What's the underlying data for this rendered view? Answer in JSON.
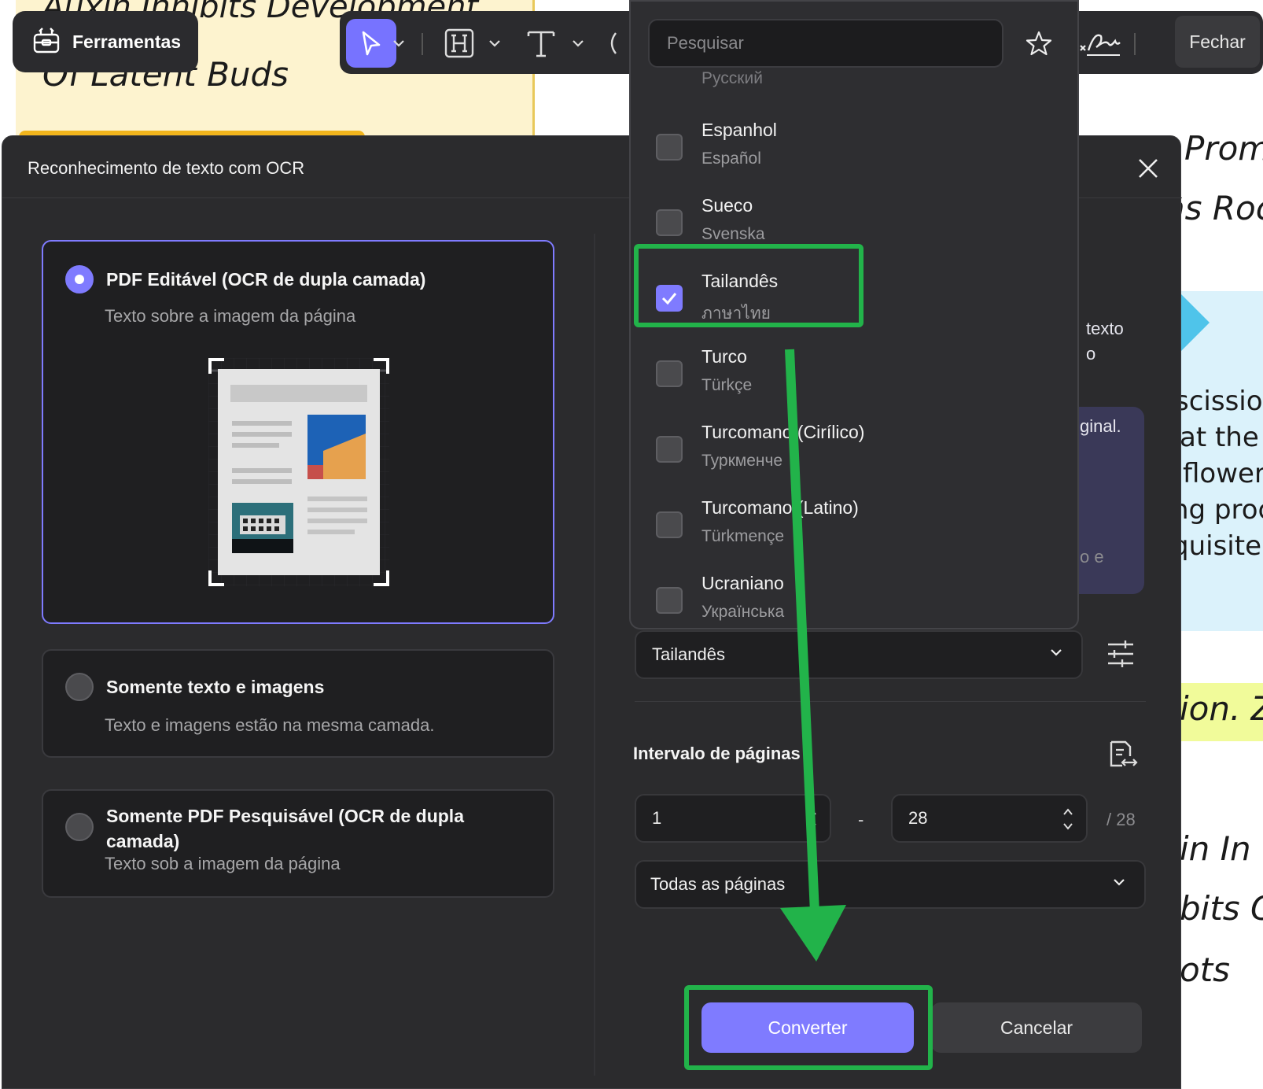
{
  "background_document": {
    "heading_line1": "Auxin Inhibits Development",
    "heading_line2": "Of Latent Buds",
    "right_texts": [
      "Prom",
      "ns Roc",
      "scission",
      "at the b",
      "flowers",
      "ng proce",
      "quisite f",
      "ion. Z",
      "in In",
      "bits C",
      "ots"
    ]
  },
  "toolbar": {
    "tools_label": "Ferramentas",
    "close_label": "Fechar"
  },
  "dialog": {
    "title": "Reconhecimento de texto com OCR",
    "options": [
      {
        "title": "PDF Editável (OCR de dupla camada)",
        "subtitle": "Texto sobre a imagem da página",
        "selected": true
      },
      {
        "title": "Somente texto e imagens",
        "subtitle": "Texto e imagens estão na mesma camada.",
        "selected": false
      },
      {
        "title": "Somente PDF Pesquisável (OCR de dupla camada)",
        "subtitle": "Texto sob a imagem da página",
        "selected": false
      }
    ],
    "tip_fragments": [
      "texto",
      "o",
      "ginal.",
      "o e"
    ],
    "language_select_value": "Tailandês",
    "page_range_label": "Intervalo de páginas",
    "page_from": "1",
    "page_separator": "-",
    "page_to": "28",
    "page_total": "/ 28",
    "page_subset_value": "Todas as páginas",
    "convert_label": "Converter",
    "cancel_label": "Cancelar"
  },
  "language_dropdown": {
    "search_placeholder": "Pesquisar",
    "partial_top": "Русский",
    "languages": [
      {
        "name": "Espanhol",
        "native": "Español",
        "checked": false
      },
      {
        "name": "Sueco",
        "native": "Svenska",
        "checked": false
      },
      {
        "name": "Tailandês",
        "native": "ภาษาไทย",
        "checked": true
      },
      {
        "name": "Turco",
        "native": "Türkçe",
        "checked": false
      },
      {
        "name": "Turcomano (Cirílico)",
        "native": "Туркменче",
        "checked": false
      },
      {
        "name": "Turcomano (Latino)",
        "native": "Türkmençe",
        "checked": false
      },
      {
        "name": "Ucraniano",
        "native": "Українська",
        "checked": false
      }
    ]
  },
  "colors": {
    "accent": "#7f7bff",
    "annotation_green": "#22b34a",
    "panel_bg": "#2b2b2d"
  }
}
